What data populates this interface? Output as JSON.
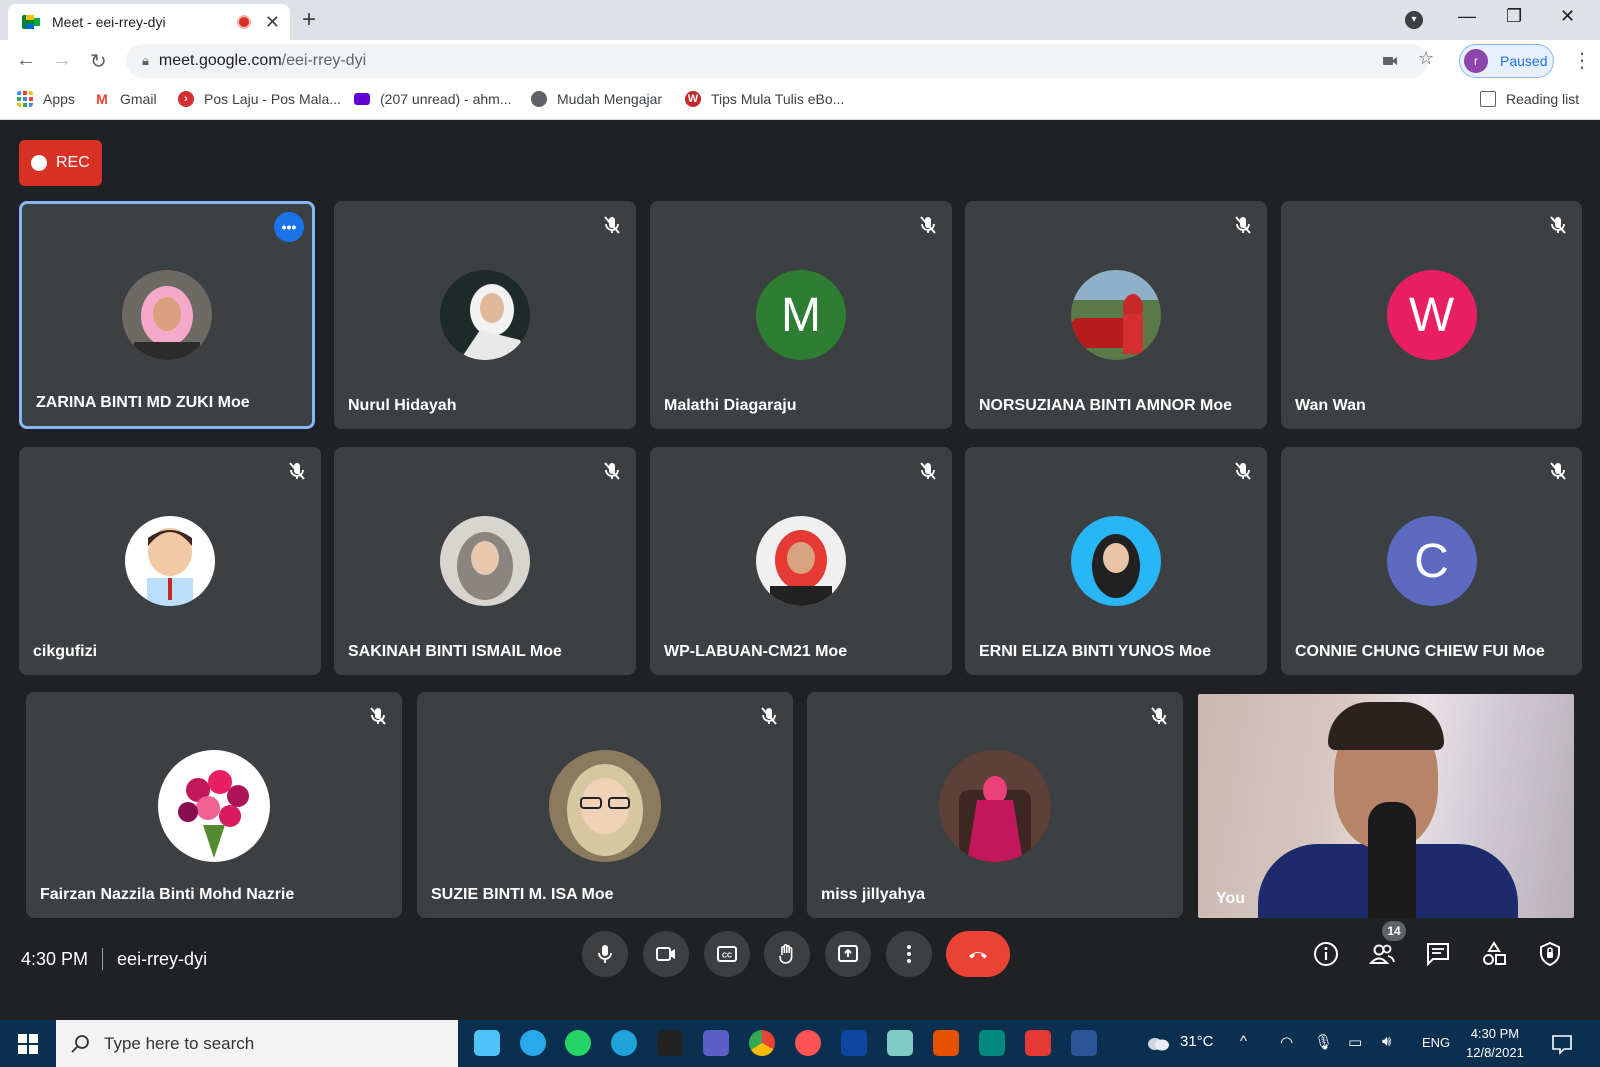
{
  "browser": {
    "tab_title": "Meet - eei-rrey-dyi",
    "url_host": "meet.google.com",
    "url_path": "/eei-rrey-dyi",
    "profile_initial": "r",
    "profile_status": "Paused",
    "bookmarks": [
      {
        "label": "Apps"
      },
      {
        "label": "Gmail"
      },
      {
        "label": "Pos Laju - Pos Mala..."
      },
      {
        "label": "(207 unread) - ahm..."
      },
      {
        "label": "Mudah Mengajar"
      },
      {
        "label": "Tips Mula Tulis eBo..."
      }
    ],
    "reading_list": "Reading list"
  },
  "meet": {
    "rec_label": "REC",
    "participants": [
      {
        "name": "ZARINA BINTI MD ZUKI Moe"
      },
      {
        "name": "Nurul Hidayah"
      },
      {
        "name": "Malathi Diagaraju",
        "initial": "M"
      },
      {
        "name": "NORSUZIANA BINTI AMNOR Moe"
      },
      {
        "name": "Wan Wan",
        "initial": "W"
      },
      {
        "name": "cikgufizi"
      },
      {
        "name": "SAKINAH BINTI ISMAIL Moe"
      },
      {
        "name": "WP-LABUAN-CM21 Moe"
      },
      {
        "name": "ERNI ELIZA BINTI YUNOS Moe"
      },
      {
        "name": "CONNIE CHUNG CHIEW FUI Moe",
        "initial": "C"
      },
      {
        "name": "Fairzan Nazzila Binti Mohd Nazrie"
      },
      {
        "name": "SUZIE BINTI M. ISA Moe"
      },
      {
        "name": "miss jillyahya"
      }
    ],
    "self_label": "You",
    "time": "4:30 PM",
    "meeting_code": "eei-rrey-dyi",
    "participant_count": "14",
    "colors": {
      "tile": "#3c4043",
      "active_border": "#8ab4f8",
      "end_call": "#ea4335",
      "malathi": "#2e7d32",
      "wan": "#e91e63",
      "connie": "#5c6bc0"
    }
  },
  "taskbar": {
    "search_placeholder": "Type here to search",
    "weather": "31°C",
    "language": "ENG",
    "time": "4:30 PM",
    "date": "12/8/2021"
  }
}
